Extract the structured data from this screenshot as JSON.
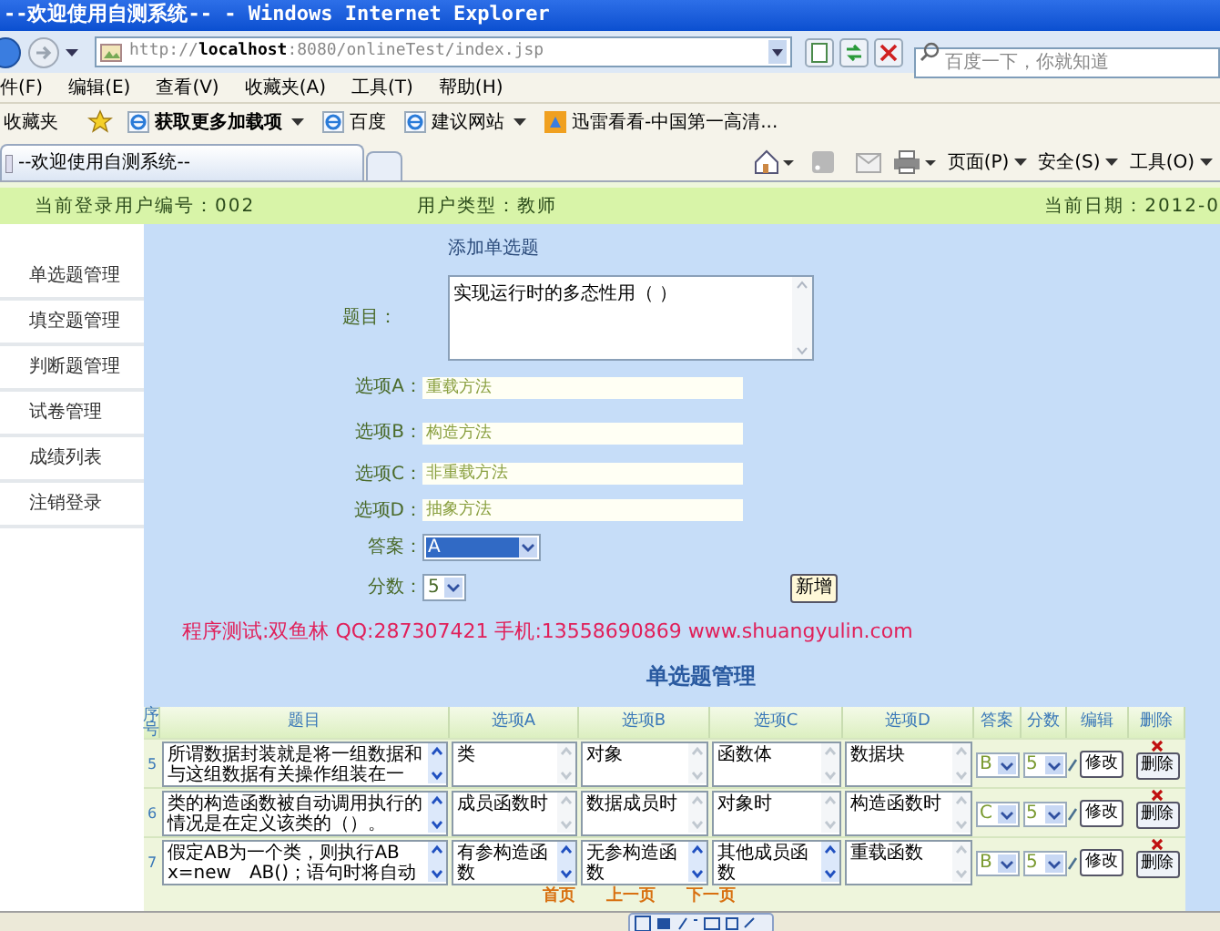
{
  "window": {
    "title": "--欢迎使用自测系统-- - Windows Internet Explorer"
  },
  "address_bar": {
    "url": "http://**localhost**:8080/onlineTest/index.jsp"
  },
  "search": {
    "placeholder": "百度一下，你就知道"
  },
  "menu": [
    "件(F)",
    "编辑(E)",
    "查看(V)",
    "收藏夹(A)",
    "工具(T)",
    "帮助(H)"
  ],
  "favorites_bar": {
    "label": "收藏夹",
    "items": [
      {
        "label": "获取更多加载项",
        "bold": true,
        "dropdown": true,
        "kind": "ie"
      },
      {
        "label": "百度",
        "bold": false,
        "dropdown": false,
        "kind": "ie"
      },
      {
        "label": "建议网站",
        "bold": false,
        "dropdown": true,
        "kind": "ie"
      },
      {
        "label": "迅雷看看-中国第一高清...",
        "bold": false,
        "dropdown": false,
        "kind": "media"
      }
    ]
  },
  "tabs": [
    {
      "label": "--欢迎使用自测系统--",
      "selected": true
    }
  ],
  "command_bar": [
    "页面(P)",
    "安全(S)",
    "工具(O)"
  ],
  "info_bar": {
    "user_id": "当前登录用户编号：002",
    "user_type": "用户类型：教师",
    "date": "当前日期：2012-0"
  },
  "sidebar": {
    "items": [
      "单选题管理",
      "填空题管理",
      "判断题管理",
      "试卷管理",
      "成绩列表",
      "注销登录"
    ]
  },
  "form": {
    "heading": "添加单选题",
    "fields": [
      {
        "kind": "textarea",
        "label": "题目：",
        "value": "实现运行时的多态性用（ ）"
      },
      {
        "kind": "text",
        "label": "选项A：",
        "value": "重载方法"
      },
      {
        "kind": "text",
        "label": "选项B：",
        "value": "构造方法"
      },
      {
        "kind": "text",
        "label": "选项C：",
        "value": "非重载方法"
      },
      {
        "kind": "text",
        "label": "选项D：",
        "value": "抽象方法"
      },
      {
        "kind": "select",
        "label": "答案：",
        "value": "A",
        "highlighted": true
      },
      {
        "kind": "select",
        "label": "分数：",
        "value": "5",
        "highlighted": false
      }
    ],
    "submit": "新增"
  },
  "credit": "程序测试:双鱼林 QQ:287307421 手机:13558690869 www.shuangyulin.com",
  "table": {
    "title": "单选题管理",
    "columns": [
      "序号",
      "题目",
      "选项A",
      "选项B",
      "选项C",
      "选项D",
      "答案",
      "分数",
      "编辑",
      "删除"
    ],
    "rows": [
      {
        "cells": [
          {
            "kind": "number",
            "text": "5"
          },
          {
            "kind": "textarea",
            "text": "所谓数据封装就是将一组数据和与这组数据有关操作组装在一",
            "scrollable": true
          },
          {
            "kind": "textarea",
            "text": "类",
            "scrollable": false
          },
          {
            "kind": "textarea",
            "text": "对象",
            "scrollable": false
          },
          {
            "kind": "textarea",
            "text": "函数体",
            "scrollable": false
          },
          {
            "kind": "textarea",
            "text": "数据块",
            "scrollable": false
          },
          {
            "kind": "select",
            "text": "B"
          },
          {
            "kind": "select",
            "text": "5"
          },
          {
            "kind": "edit",
            "text": "修改"
          },
          {
            "kind": "delete",
            "text": "删除"
          }
        ]
      },
      {
        "cells": [
          {
            "kind": "number",
            "text": "6"
          },
          {
            "kind": "textarea",
            "text": "类的构造函数被自动调用执行的情况是在定义该类的（）。",
            "scrollable": true
          },
          {
            "kind": "textarea",
            "text": "成员函数时",
            "scrollable": false
          },
          {
            "kind": "textarea",
            "text": "数据成员时",
            "scrollable": false
          },
          {
            "kind": "textarea",
            "text": "对象时",
            "scrollable": false
          },
          {
            "kind": "textarea",
            "text": "构造函数时",
            "scrollable": false
          },
          {
            "kind": "select",
            "text": "C"
          },
          {
            "kind": "select",
            "text": "5"
          },
          {
            "kind": "edit",
            "text": "修改"
          },
          {
            "kind": "delete",
            "text": "删除"
          }
        ]
      },
      {
        "cells": [
          {
            "kind": "number",
            "text": "7"
          },
          {
            "kind": "textarea",
            "text": "假定AB为一个类，则执行AB x=new　AB()；语句时将自动",
            "scrollable": true
          },
          {
            "kind": "textarea",
            "text": "有参构造函数",
            "scrollable": true
          },
          {
            "kind": "textarea",
            "text": "无参构造函数",
            "scrollable": true
          },
          {
            "kind": "textarea",
            "text": "其他成员函数",
            "scrollable": true
          },
          {
            "kind": "textarea",
            "text": "重载函数",
            "scrollable": false
          },
          {
            "kind": "select",
            "text": "B"
          },
          {
            "kind": "select",
            "text": "5"
          },
          {
            "kind": "edit",
            "text": "修改"
          },
          {
            "kind": "delete",
            "text": "删除"
          }
        ]
      }
    ]
  },
  "pagination": [
    "首页",
    "上一页",
    "下一页"
  ]
}
